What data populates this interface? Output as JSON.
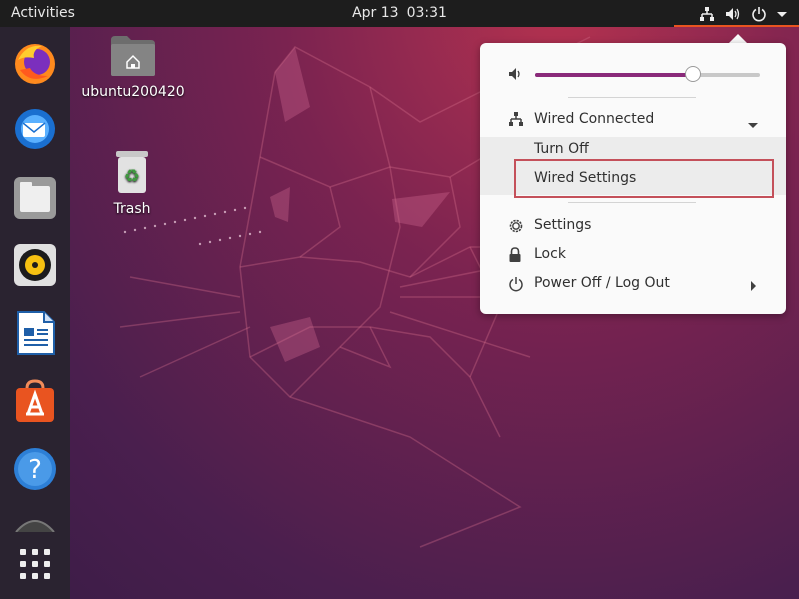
{
  "topbar": {
    "activities": "Activities",
    "date": "Apr 13",
    "time": "03:31"
  },
  "desktop": {
    "home_label": "ubuntu200420",
    "trash_label": "Trash"
  },
  "menu": {
    "volume_level": 0.7,
    "wired_connected": "Wired Connected",
    "turn_off": "Turn Off",
    "wired_settings": "Wired Settings",
    "settings": "Settings",
    "lock": "Lock",
    "power_off": "Power Off / Log Out"
  },
  "colors": {
    "accent": "#e95420",
    "slider_fill": "#8a2a7a",
    "highlight_border": "#c4505a"
  }
}
